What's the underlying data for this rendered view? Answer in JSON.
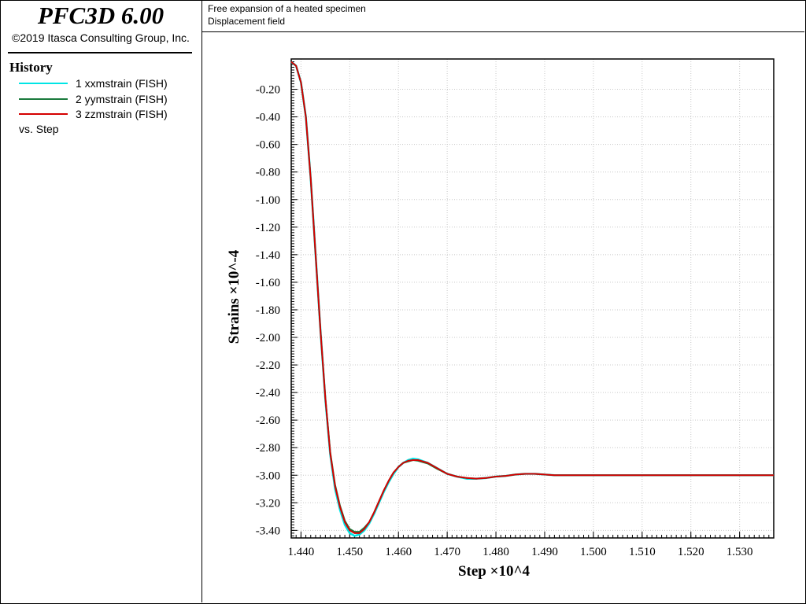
{
  "app": {
    "title": "PFC3D 6.00",
    "copyright": "©2019 Itasca Consulting Group, Inc."
  },
  "header": {
    "line1": "Free expansion of a heated specimen",
    "line2": "Displacement field"
  },
  "legend": {
    "heading": "History",
    "items": [
      {
        "label": "1 xxmstrain (FISH)",
        "color": "#00e5e5"
      },
      {
        "label": "2 yymstrain (FISH)",
        "color": "#1a7a3c"
      },
      {
        "label": "3 zzmstrain (FISH)",
        "color": "#d40000"
      }
    ],
    "vs": "vs. Step"
  },
  "chart_data": {
    "type": "line",
    "xlabel": "Step ×10^4",
    "ylabel": "Strains ×10^-4",
    "xlim": [
      1.438,
      1.537
    ],
    "ylim": [
      -3.455,
      0.02
    ],
    "x_ticks": [
      "1.440",
      "1.450",
      "1.460",
      "1.470",
      "1.480",
      "1.490",
      "1.500",
      "1.510",
      "1.520",
      "1.530"
    ],
    "y_ticks": [
      "-0.20",
      "-0.40",
      "-0.60",
      "-0.80",
      "-1.00",
      "-1.20",
      "-1.40",
      "-1.60",
      "-1.80",
      "-2.00",
      "-2.20",
      "-2.40",
      "-2.60",
      "-2.80",
      "-3.00",
      "-3.20",
      "-3.40"
    ],
    "grid": true,
    "series": [
      {
        "name": "1 xxmstrain (FISH)",
        "color": "#00e5e5",
        "x": [
          1.438,
          1.439,
          1.44,
          1.441,
          1.442,
          1.443,
          1.444,
          1.445,
          1.446,
          1.447,
          1.448,
          1.449,
          1.45,
          1.451,
          1.452,
          1.453,
          1.454,
          1.455,
          1.456,
          1.457,
          1.458,
          1.459,
          1.46,
          1.461,
          1.462,
          1.463,
          1.464,
          1.466,
          1.468,
          1.47,
          1.472,
          1.474,
          1.476,
          1.478,
          1.48,
          1.482,
          1.484,
          1.486,
          1.488,
          1.49,
          1.492,
          1.495,
          1.5,
          1.51,
          1.52,
          1.53,
          1.537
        ],
        "y": [
          0.0,
          -0.03,
          -0.15,
          -0.4,
          -0.85,
          -1.4,
          -1.95,
          -2.45,
          -2.85,
          -3.1,
          -3.25,
          -3.36,
          -3.42,
          -3.44,
          -3.43,
          -3.4,
          -3.35,
          -3.28,
          -3.2,
          -3.12,
          -3.05,
          -2.99,
          -2.94,
          -2.91,
          -2.89,
          -2.88,
          -2.885,
          -2.91,
          -2.95,
          -2.99,
          -3.01,
          -3.025,
          -3.025,
          -3.02,
          -3.01,
          -3.005,
          -2.995,
          -2.99,
          -2.99,
          -2.995,
          -3.0,
          -3.0,
          -3.0,
          -3.0,
          -3.0,
          -3.0,
          -3.0
        ]
      },
      {
        "name": "2 yymstrain (FISH)",
        "color": "#1a7a3c",
        "x": [
          1.438,
          1.439,
          1.44,
          1.441,
          1.442,
          1.443,
          1.444,
          1.445,
          1.446,
          1.447,
          1.448,
          1.449,
          1.45,
          1.451,
          1.452,
          1.453,
          1.454,
          1.455,
          1.456,
          1.457,
          1.458,
          1.459,
          1.46,
          1.461,
          1.462,
          1.463,
          1.464,
          1.466,
          1.468,
          1.47,
          1.472,
          1.474,
          1.476,
          1.478,
          1.48,
          1.482,
          1.484,
          1.486,
          1.488,
          1.49,
          1.492,
          1.495,
          1.5,
          1.51,
          1.52,
          1.53,
          1.537
        ],
        "y": [
          0.0,
          -0.03,
          -0.15,
          -0.4,
          -0.85,
          -1.4,
          -1.95,
          -2.44,
          -2.83,
          -3.07,
          -3.22,
          -3.33,
          -3.39,
          -3.41,
          -3.41,
          -3.38,
          -3.34,
          -3.27,
          -3.19,
          -3.11,
          -3.04,
          -2.98,
          -2.94,
          -2.91,
          -2.9,
          -2.89,
          -2.895,
          -2.915,
          -2.955,
          -2.99,
          -3.01,
          -3.02,
          -3.025,
          -3.02,
          -3.01,
          -3.005,
          -2.995,
          -2.99,
          -2.99,
          -2.995,
          -3.0,
          -3.0,
          -3.0,
          -3.0,
          -3.0,
          -3.0,
          -3.0
        ]
      },
      {
        "name": "3 zzmstrain (FISH)",
        "color": "#d40000",
        "x": [
          1.438,
          1.439,
          1.44,
          1.441,
          1.442,
          1.443,
          1.444,
          1.445,
          1.446,
          1.447,
          1.448,
          1.449,
          1.45,
          1.451,
          1.452,
          1.453,
          1.454,
          1.455,
          1.456,
          1.457,
          1.458,
          1.459,
          1.46,
          1.461,
          1.462,
          1.463,
          1.464,
          1.466,
          1.468,
          1.47,
          1.472,
          1.474,
          1.476,
          1.478,
          1.48,
          1.482,
          1.484,
          1.486,
          1.488,
          1.49,
          1.492,
          1.495,
          1.5,
          1.51,
          1.52,
          1.53,
          1.537
        ],
        "y": [
          0.0,
          -0.03,
          -0.15,
          -0.4,
          -0.85,
          -1.4,
          -1.95,
          -2.44,
          -2.84,
          -3.08,
          -3.23,
          -3.34,
          -3.4,
          -3.42,
          -3.42,
          -3.39,
          -3.34,
          -3.27,
          -3.19,
          -3.11,
          -3.04,
          -2.98,
          -2.94,
          -2.91,
          -2.895,
          -2.89,
          -2.89,
          -2.91,
          -2.95,
          -2.99,
          -3.01,
          -3.02,
          -3.025,
          -3.02,
          -3.01,
          -3.005,
          -2.995,
          -2.99,
          -2.99,
          -2.995,
          -3.0,
          -3.0,
          -3.0,
          -3.0,
          -3.0,
          -3.0,
          -3.0
        ]
      }
    ]
  }
}
